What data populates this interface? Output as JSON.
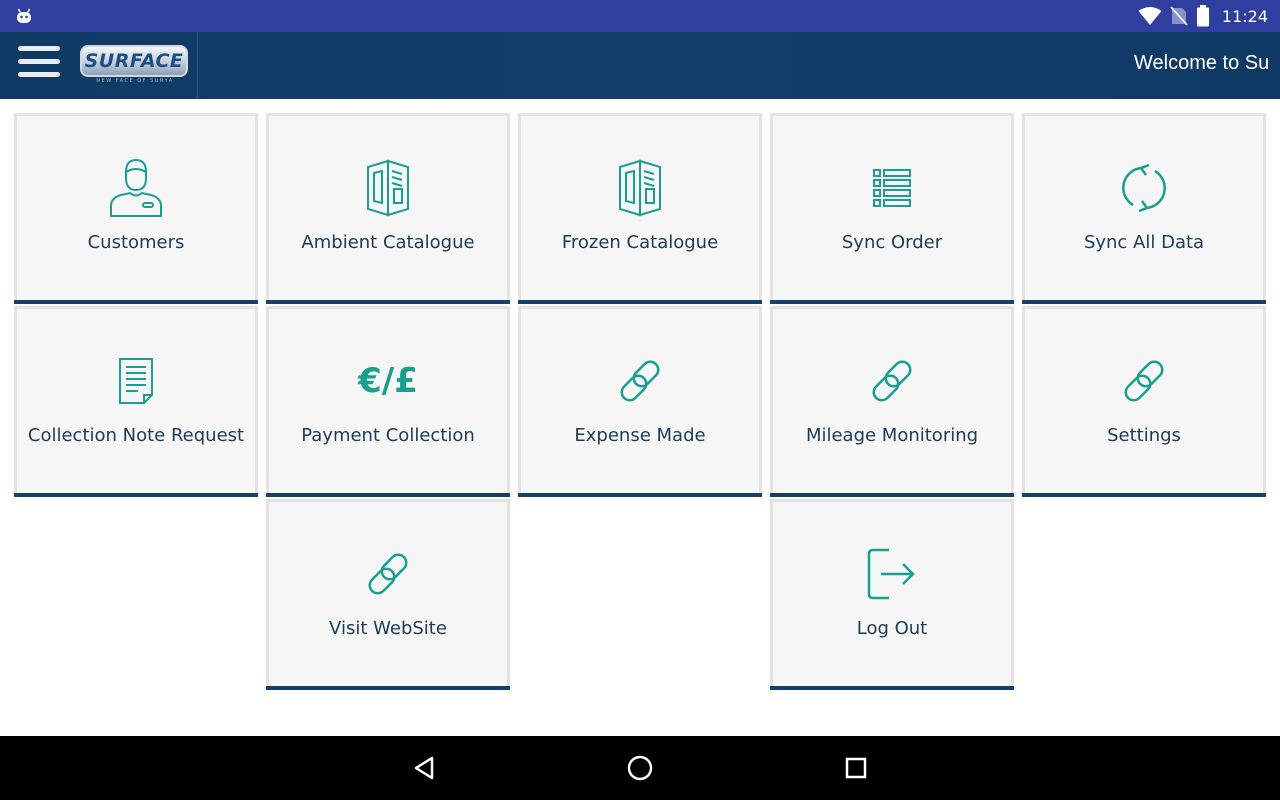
{
  "status_bar": {
    "time": "11:24",
    "icons": [
      "android-icon",
      "wifi-icon",
      "no-sim-icon",
      "battery-icon"
    ]
  },
  "app_bar": {
    "logo_text": "SURFACE",
    "logo_tagline": "NEW FACE OF SURYA",
    "welcome_text": "Welcome to Su",
    "menu_icon": "hamburger-menu-icon"
  },
  "tiles": [
    {
      "label": "Customers",
      "icon": "customer-person-icon"
    },
    {
      "label": "Ambient Catalogue",
      "icon": "catalogue-book-icon"
    },
    {
      "label": "Frozen Catalogue",
      "icon": "catalogue-book-icon"
    },
    {
      "label": "Sync Order",
      "icon": "list-icon"
    },
    {
      "label": "Sync All Data",
      "icon": "sync-icon"
    },
    {
      "label": "Collection Note Request",
      "icon": "document-icon"
    },
    {
      "label": "Payment Collection",
      "icon_text": "€/£",
      "icon": "currency-icon"
    },
    {
      "label": "Expense Made",
      "icon": "link-icon"
    },
    {
      "label": "Mileage Monitoring",
      "icon": "link-icon"
    },
    {
      "label": "Settings",
      "icon": "link-icon"
    },
    {
      "label": "Visit WebSite",
      "icon": "link-icon"
    },
    {
      "label": "Log Out",
      "icon": "logout-icon"
    }
  ],
  "colors": {
    "status_bar": "#303f9f",
    "app_bar": "#123f6b",
    "tile_bg": "#f6f6f6",
    "tile_accent": "#173f6e",
    "icon_teal": "#1a9e8f",
    "label_text": "#1f3a57"
  },
  "nav_bar": {
    "buttons": [
      "back-icon",
      "home-icon",
      "recents-icon"
    ]
  }
}
